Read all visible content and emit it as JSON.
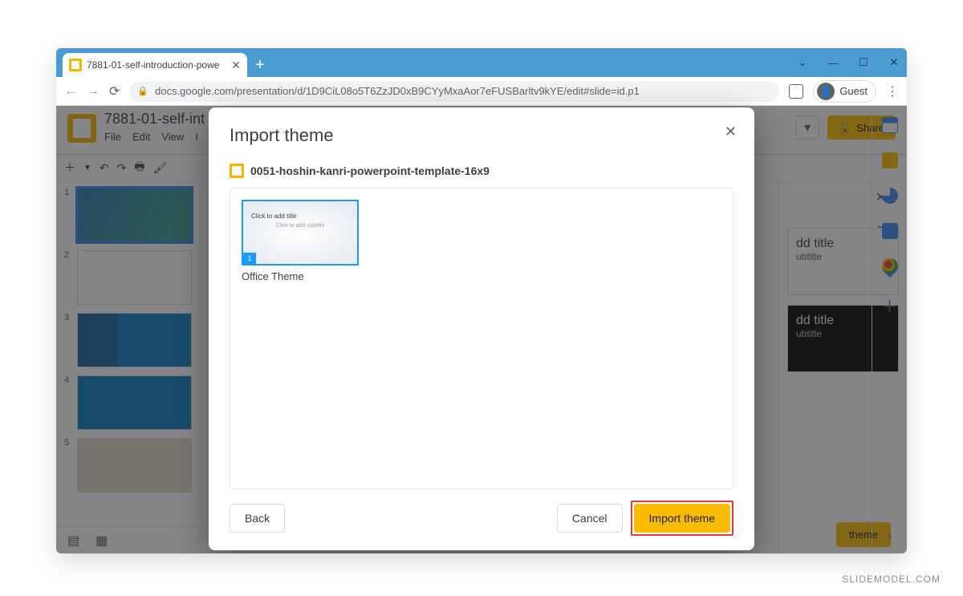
{
  "browser": {
    "tab_title": "7881-01-self-introduction-powe",
    "url": "docs.google.com/presentation/d/1D9CiL08o5T6ZzJD0xB9CYyMxaAor7eFUSBarltv9kYE/edit#slide=id.p1",
    "guest_label": "Guest",
    "win": {
      "min": "—",
      "max": "☐",
      "close": "✕",
      "chev": "⌄"
    }
  },
  "app": {
    "doc_title": "7881-01-self-int",
    "menus": [
      "File",
      "Edit",
      "View",
      "I"
    ],
    "share_label": "Share",
    "themes_panel": {
      "card1_title": "dd title",
      "card1_sub": "ubtitle",
      "card2_title": "dd title",
      "card2_sub": "ubtitle",
      "import_btn": "theme"
    },
    "filmstrip": [
      "1",
      "2",
      "3",
      "4",
      "5"
    ]
  },
  "dialog": {
    "title": "Import theme",
    "file_name": "0051-hoshin-kanri-powerpoint-template-16x9",
    "theme": {
      "preview_title": "Click to add title",
      "preview_sub": "Click to add subtitle",
      "badge": "1",
      "name": "Office Theme"
    },
    "buttons": {
      "back": "Back",
      "cancel": "Cancel",
      "import": "Import theme"
    }
  },
  "watermark": "SLIDEMODEL.COM"
}
